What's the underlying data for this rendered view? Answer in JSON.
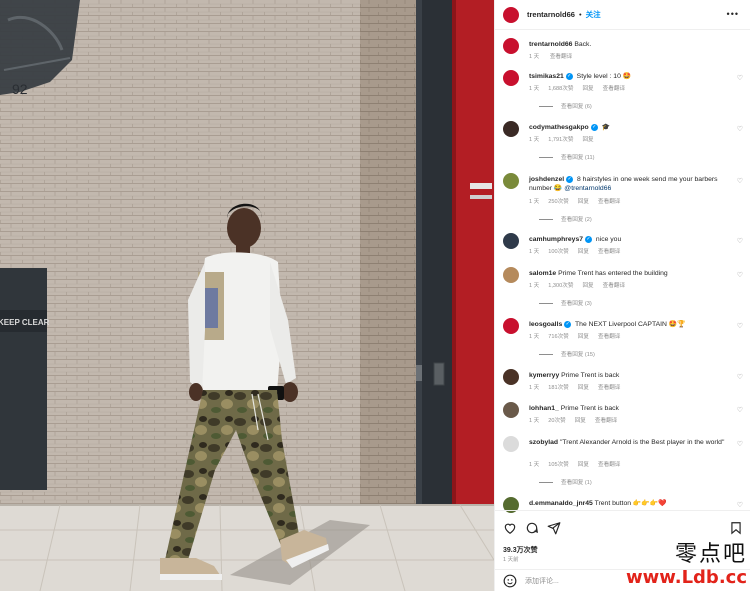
{
  "post": {
    "author": "trentarnold66",
    "follow_label": "关注",
    "more_label": "•••",
    "caption": {
      "user": "trentarnold66",
      "text": "Back.",
      "meta": [
        "1 天",
        "查看翻译"
      ]
    }
  },
  "photo": {
    "sign_text": "KEEP CLEAR",
    "crest_text": "92"
  },
  "comments": [
    {
      "user": "tsimikas21",
      "verified": true,
      "text": "Style level : 10 🤩",
      "meta": [
        "1 天",
        "1,688次赞",
        "回复",
        "查看翻译"
      ],
      "replies": "查看回复 (6)",
      "avatar_color": "#c8102e"
    },
    {
      "user": "codymathesgakpo",
      "verified": true,
      "text": "🎓",
      "meta": [
        "1 天",
        "1,791次赞",
        "回复"
      ],
      "replies": "查看回复 (11)",
      "avatar_color": "#3a2a25"
    },
    {
      "user": "joshdenzel",
      "verified": true,
      "text": "8 hairstyles in one week send me your barbers number 😂",
      "mention": "@trentarnold66",
      "meta": [
        "1 天",
        "250次赞",
        "回复",
        "查看翻译"
      ],
      "replies": "查看回复 (2)",
      "avatar_color": "#7a8a3a"
    },
    {
      "user": "camhumphreys7",
      "verified": true,
      "text": "nice you",
      "meta": [
        "1 天",
        "100次赞",
        "回复",
        "查看翻译"
      ],
      "replies": "",
      "avatar_color": "#2f3a4a"
    },
    {
      "user": "salom1e",
      "verified": false,
      "text": "Prime Trent has entered the building",
      "meta": [
        "1 天",
        "1,300次赞",
        "回复",
        "查看翻译"
      ],
      "replies": "查看回复 (3)",
      "avatar_color": "#b58a5c"
    },
    {
      "user": "leosgoalls",
      "verified": true,
      "text": "The NEXT Liverpool CAPTAIN 🤩🏆",
      "meta": [
        "1 天",
        "716次赞",
        "回复",
        "查看翻译"
      ],
      "replies": "查看回复 (15)",
      "avatar_color": "#c8102e"
    },
    {
      "user": "kymerryy",
      "verified": false,
      "text": "Prime Trent is back",
      "meta": [
        "1 天",
        "181次赞",
        "回复",
        "查看翻译"
      ],
      "replies": "",
      "avatar_color": "#4a3226"
    },
    {
      "user": "lohhan1_",
      "verified": false,
      "text": "Prime Trent is back",
      "meta": [
        "1 天",
        "20次赞",
        "回复",
        "查看翻译"
      ],
      "replies": "",
      "avatar_color": "#6a5a4a"
    },
    {
      "user": "szobylad",
      "verified": false,
      "text": "\"Trent Alexander Arnold is the Best player in the world\"",
      "meta": [
        "1 天",
        "105次赞",
        "回复",
        "查看翻译"
      ],
      "replies": "查看回复 (1)",
      "avatar_color": "#dbdbdb"
    },
    {
      "user": "d.emmanaldo_jnr45",
      "verified": false,
      "text": "Trent button 👉👉👉❤️",
      "meta": [],
      "replies": "",
      "avatar_color": "#556b2f"
    }
  ],
  "footer": {
    "likes": "39.3万次赞",
    "time": "1 天前",
    "add_comment_placeholder": "添加评论..."
  },
  "watermark": {
    "cn": "零点吧",
    "url": "www.Ldb.cc"
  },
  "colors": {
    "accent": "#0095f6",
    "brand_red": "#c8102e"
  }
}
